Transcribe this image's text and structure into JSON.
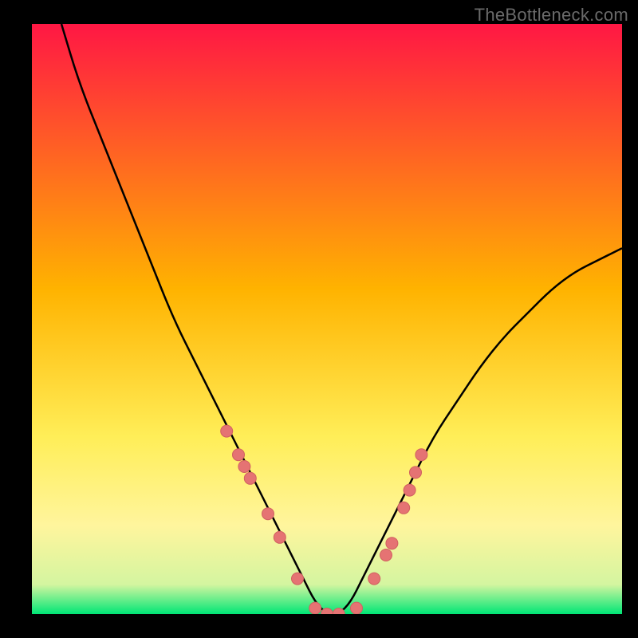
{
  "watermark": "TheBottleneck.com",
  "chart_data": {
    "type": "line",
    "title": "",
    "xlabel": "",
    "ylabel": "",
    "xlim": [
      0,
      100
    ],
    "ylim": [
      0,
      100
    ],
    "grid": false,
    "series": [
      {
        "name": "curve",
        "x": [
          5,
          8,
          12,
          16,
          20,
          24,
          28,
          32,
          36,
          38,
          40,
          42,
          44,
          46,
          48,
          50,
          52,
          54,
          56,
          58,
          60,
          64,
          68,
          72,
          76,
          80,
          84,
          88,
          92,
          96,
          100
        ],
        "y": [
          100,
          90,
          80,
          70,
          60,
          50,
          42,
          34,
          26,
          22,
          18,
          14,
          10,
          6,
          2,
          0,
          0,
          2,
          6,
          10,
          14,
          22,
          30,
          36,
          42,
          47,
          51,
          55,
          58,
          60,
          62
        ]
      }
    ],
    "markers": {
      "name": "dots",
      "x": [
        33,
        35,
        36,
        37,
        40,
        42,
        45,
        48,
        50,
        52,
        55,
        58,
        60,
        61,
        63,
        64,
        65,
        66
      ],
      "y": [
        31,
        27,
        25,
        23,
        17,
        13,
        6,
        1,
        0,
        0,
        1,
        6,
        10,
        12,
        18,
        21,
        24,
        27
      ]
    },
    "background_gradient": {
      "stops": [
        {
          "offset": 0.0,
          "color": "#ff1744"
        },
        {
          "offset": 0.45,
          "color": "#ffb300"
        },
        {
          "offset": 0.7,
          "color": "#ffee58"
        },
        {
          "offset": 0.85,
          "color": "#fff59d"
        },
        {
          "offset": 0.95,
          "color": "#d4f5a0"
        },
        {
          "offset": 1.0,
          "color": "#00e676"
        }
      ]
    },
    "colors": {
      "curve": "#000000",
      "marker_fill": "#e57373",
      "marker_stroke": "#d06060"
    }
  }
}
